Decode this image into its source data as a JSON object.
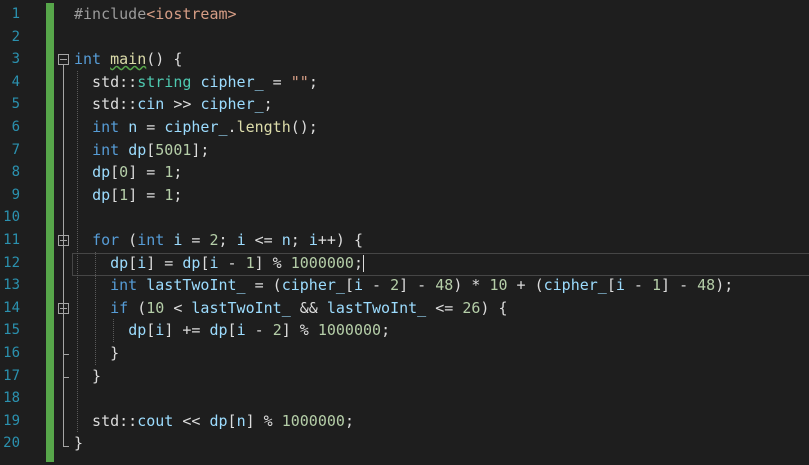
{
  "editor": {
    "lines": [
      {
        "n": "1",
        "tokens": [
          [
            "pre",
            "#include"
          ],
          [
            "inc",
            "<iostream>"
          ]
        ]
      },
      {
        "n": "2",
        "tokens": []
      },
      {
        "n": "3",
        "tokens": [
          [
            "kw",
            "int"
          ],
          [
            "plain",
            " "
          ],
          [
            "fn",
            "main"
          ],
          [
            "plain",
            "() {"
          ]
        ]
      },
      {
        "n": "4",
        "tokens": [
          [
            "plain",
            "  std"
          ],
          [
            "ns",
            "::"
          ],
          [
            "type",
            "string"
          ],
          [
            "plain",
            " "
          ],
          [
            "var",
            "cipher_"
          ],
          [
            "plain",
            " = "
          ],
          [
            "str",
            "\"\""
          ],
          [
            "plain",
            ";"
          ]
        ]
      },
      {
        "n": "5",
        "tokens": [
          [
            "plain",
            "  std"
          ],
          [
            "ns",
            "::"
          ],
          [
            "var",
            "cin"
          ],
          [
            "plain",
            " >> "
          ],
          [
            "var",
            "cipher_"
          ],
          [
            "plain",
            ";"
          ]
        ]
      },
      {
        "n": "6",
        "tokens": [
          [
            "plain",
            "  "
          ],
          [
            "kw",
            "int"
          ],
          [
            "plain",
            " "
          ],
          [
            "var",
            "n"
          ],
          [
            "plain",
            " = "
          ],
          [
            "var",
            "cipher_"
          ],
          [
            "plain",
            "."
          ],
          [
            "fn",
            "length"
          ],
          [
            "plain",
            "();"
          ]
        ]
      },
      {
        "n": "7",
        "tokens": [
          [
            "plain",
            "  "
          ],
          [
            "kw",
            "int"
          ],
          [
            "plain",
            " "
          ],
          [
            "var",
            "dp"
          ],
          [
            "plain",
            "["
          ],
          [
            "num",
            "5001"
          ],
          [
            "plain",
            "];"
          ]
        ]
      },
      {
        "n": "8",
        "tokens": [
          [
            "plain",
            "  "
          ],
          [
            "var",
            "dp"
          ],
          [
            "plain",
            "["
          ],
          [
            "num",
            "0"
          ],
          [
            "plain",
            "] = "
          ],
          [
            "num",
            "1"
          ],
          [
            "plain",
            ";"
          ]
        ]
      },
      {
        "n": "9",
        "tokens": [
          [
            "plain",
            "  "
          ],
          [
            "var",
            "dp"
          ],
          [
            "plain",
            "["
          ],
          [
            "num",
            "1"
          ],
          [
            "plain",
            "] = "
          ],
          [
            "num",
            "1"
          ],
          [
            "plain",
            ";"
          ]
        ]
      },
      {
        "n": "10",
        "tokens": []
      },
      {
        "n": "11",
        "tokens": [
          [
            "plain",
            "  "
          ],
          [
            "kw",
            "for"
          ],
          [
            "plain",
            " ("
          ],
          [
            "kw",
            "int"
          ],
          [
            "plain",
            " "
          ],
          [
            "var",
            "i"
          ],
          [
            "plain",
            " = "
          ],
          [
            "num",
            "2"
          ],
          [
            "plain",
            "; "
          ],
          [
            "var",
            "i"
          ],
          [
            "plain",
            " <= "
          ],
          [
            "var",
            "n"
          ],
          [
            "plain",
            "; "
          ],
          [
            "var",
            "i"
          ],
          [
            "plain",
            "++) {"
          ]
        ]
      },
      {
        "n": "12",
        "tokens": [
          [
            "plain",
            "    "
          ],
          [
            "var",
            "dp"
          ],
          [
            "plain",
            "["
          ],
          [
            "var",
            "i"
          ],
          [
            "plain",
            "] = "
          ],
          [
            "var",
            "dp"
          ],
          [
            "plain",
            "["
          ],
          [
            "var",
            "i"
          ],
          [
            "plain",
            " - "
          ],
          [
            "num",
            "1"
          ],
          [
            "plain",
            "] % "
          ],
          [
            "num",
            "1000000"
          ],
          [
            "plain",
            ";"
          ]
        ]
      },
      {
        "n": "13",
        "tokens": [
          [
            "plain",
            "    "
          ],
          [
            "kw",
            "int"
          ],
          [
            "plain",
            " "
          ],
          [
            "var",
            "lastTwoInt_"
          ],
          [
            "plain",
            " = ("
          ],
          [
            "var",
            "cipher_"
          ],
          [
            "plain",
            "["
          ],
          [
            "var",
            "i"
          ],
          [
            "plain",
            " - "
          ],
          [
            "num",
            "2"
          ],
          [
            "plain",
            "] - "
          ],
          [
            "num",
            "48"
          ],
          [
            "plain",
            ") * "
          ],
          [
            "num",
            "10"
          ],
          [
            "plain",
            " + ("
          ],
          [
            "var",
            "cipher_"
          ],
          [
            "plain",
            "["
          ],
          [
            "var",
            "i"
          ],
          [
            "plain",
            " - "
          ],
          [
            "num",
            "1"
          ],
          [
            "plain",
            "] - "
          ],
          [
            "num",
            "48"
          ],
          [
            "plain",
            ");"
          ]
        ]
      },
      {
        "n": "14",
        "tokens": [
          [
            "plain",
            "    "
          ],
          [
            "kw",
            "if"
          ],
          [
            "plain",
            " ("
          ],
          [
            "num",
            "10"
          ],
          [
            "plain",
            " < "
          ],
          [
            "var",
            "lastTwoInt_"
          ],
          [
            "plain",
            " && "
          ],
          [
            "var",
            "lastTwoInt_"
          ],
          [
            "plain",
            " <= "
          ],
          [
            "num",
            "26"
          ],
          [
            "plain",
            ") {"
          ]
        ]
      },
      {
        "n": "15",
        "tokens": [
          [
            "plain",
            "      "
          ],
          [
            "var",
            "dp"
          ],
          [
            "plain",
            "["
          ],
          [
            "var",
            "i"
          ],
          [
            "plain",
            "] += "
          ],
          [
            "var",
            "dp"
          ],
          [
            "plain",
            "["
          ],
          [
            "var",
            "i"
          ],
          [
            "plain",
            " - "
          ],
          [
            "num",
            "2"
          ],
          [
            "plain",
            "] % "
          ],
          [
            "num",
            "1000000"
          ],
          [
            "plain",
            ";"
          ]
        ]
      },
      {
        "n": "16",
        "tokens": [
          [
            "plain",
            "    }"
          ]
        ]
      },
      {
        "n": "17",
        "tokens": [
          [
            "plain",
            "  }"
          ]
        ]
      },
      {
        "n": "18",
        "tokens": []
      },
      {
        "n": "19",
        "tokens": [
          [
            "plain",
            "  std"
          ],
          [
            "ns",
            "::"
          ],
          [
            "var",
            "cout"
          ],
          [
            "plain",
            " << "
          ],
          [
            "var",
            "dp"
          ],
          [
            "plain",
            "["
          ],
          [
            "var",
            "n"
          ],
          [
            "plain",
            "] % "
          ],
          [
            "num",
            "1000000"
          ],
          [
            "plain",
            ";"
          ]
        ]
      },
      {
        "n": "20",
        "tokens": [
          [
            "plain",
            "}"
          ]
        ]
      }
    ],
    "current_line": "12",
    "fold_lines": [
      "3",
      "11",
      "14"
    ],
    "colors": {
      "background": "#1e1e1e",
      "line_number": "#2b91af",
      "keyword": "#569cd6",
      "string": "#d69d85",
      "change_bar": "#57a64a"
    }
  }
}
